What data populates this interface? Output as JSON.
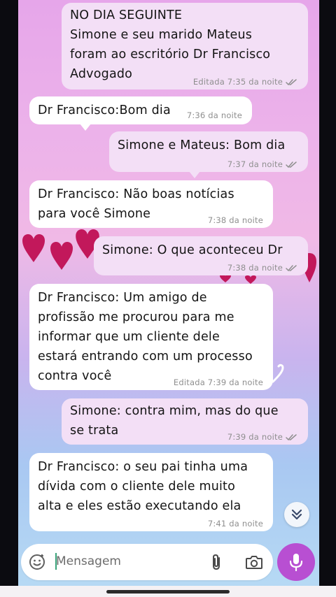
{
  "messages": [
    {
      "id": "m1",
      "text": "NO DIA SEGUINTE\nSimone e seu marido Mateus\nforam ao escritório Dr Francisco\nAdvogado",
      "meta": "Editada 7:35 da noite",
      "direction": "out"
    },
    {
      "id": "m2",
      "text": "Dr Francisco:Bom dia",
      "meta": "7:36 da noite",
      "direction": "in"
    },
    {
      "id": "m3",
      "text": "Simone e Mateus: Bom dia",
      "meta": "7:37 da noite",
      "direction": "out"
    },
    {
      "id": "m4",
      "text": "Dr Francisco: Não boas notícias\npara você Simone",
      "meta": "7:38 da noite",
      "direction": "in"
    },
    {
      "id": "m5",
      "text": "Simone: O que aconteceu Dr",
      "meta": "7:38 da noite",
      "direction": "out"
    },
    {
      "id": "m6",
      "text": "Dr Francisco: Um amigo de\nprofissão me procurou para me\ninformar que um cliente dele\nestará entrando com um processo\ncontra você",
      "meta": "Editada 7:39 da noite",
      "direction": "in"
    },
    {
      "id": "m7",
      "text": "Simone: contra mim, mas do que\nse trata",
      "meta": "7:39 da noite",
      "direction": "out"
    },
    {
      "id": "m8",
      "text": "Dr Francisco: o seu pai tinha uma\ndívida com o cliente dele muito\nalta e eles estão executando ela",
      "meta": "7:41 da noite",
      "direction": "in"
    }
  ],
  "composer": {
    "placeholder": "Mensagem",
    "emoji_icon": "emoji-icon",
    "attach_icon": "paperclip-icon",
    "camera_icon": "camera-icon",
    "mic_icon": "microphone-icon"
  },
  "colors": {
    "incoming_bubble": "#ffffff",
    "outgoing_bubble": "#f3dff6",
    "mic_button": "#b84fd2",
    "heart": "#c2185b"
  }
}
